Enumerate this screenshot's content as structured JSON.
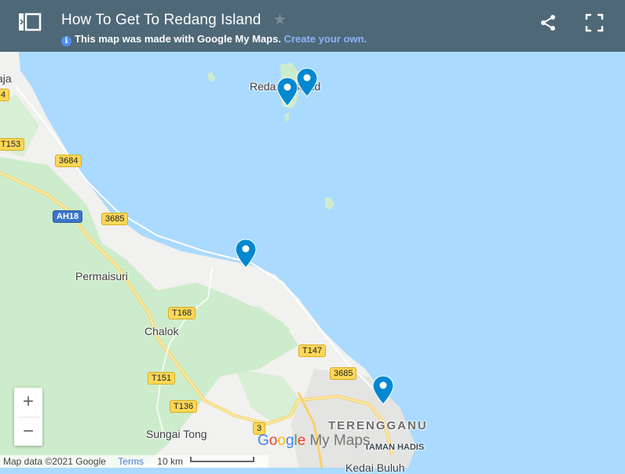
{
  "header": {
    "title": "How To Get To Redang Island",
    "subline_text": "This map was made with Google My Maps.",
    "subline_link": "Create your own.",
    "icons": [
      "panel-toggle-icon",
      "star-icon",
      "info-icon",
      "share-icon",
      "fullscreen-icon"
    ],
    "background_color": "#4e6878"
  },
  "map": {
    "water_color": "#aadaff",
    "land_color": "#f1f1ef",
    "forest_color": "#cdeccb",
    "pin_color": "#0288d1",
    "place_labels": [
      {
        "id": "redang-island",
        "text": "Redang Island"
      },
      {
        "id": "kuala-besut-partial",
        "text": "aja"
      },
      {
        "id": "permaisuri",
        "text": "Permaisuri"
      },
      {
        "id": "chalok",
        "text": "Chalok"
      },
      {
        "id": "sungai-tong",
        "text": "Sungai Tong"
      },
      {
        "id": "terengganu",
        "text": "TERENGGANU"
      },
      {
        "id": "taman-hadis",
        "text": "TAMAN HADIS"
      },
      {
        "id": "kedai-buluh",
        "text": "Kedai Buluh"
      }
    ],
    "road_shields": [
      {
        "id": "r4",
        "text": "4"
      },
      {
        "id": "t153",
        "text": "T153"
      },
      {
        "id": "r3684",
        "text": "3684"
      },
      {
        "id": "ah18",
        "text": "AH18"
      },
      {
        "id": "r3685a",
        "text": "3685"
      },
      {
        "id": "t168",
        "text": "T168"
      },
      {
        "id": "t147",
        "text": "T147"
      },
      {
        "id": "r3685b",
        "text": "3685"
      },
      {
        "id": "t151",
        "text": "T151"
      },
      {
        "id": "t136",
        "text": "T136"
      },
      {
        "id": "r3",
        "text": "3"
      }
    ],
    "markers": [
      {
        "name": "Redang Island marker 1"
      },
      {
        "name": "Redang Island marker 2"
      },
      {
        "name": "Merang jetty marker"
      },
      {
        "name": "Kuala Terengganu marker"
      }
    ]
  },
  "controls": {
    "zoom_in": "+",
    "zoom_out": "−"
  },
  "footer": {
    "attribution": "Map data ©2021 Google",
    "terms": "Terms",
    "scale": "10 km",
    "logo_google": [
      "G",
      "o",
      "o",
      "g",
      "l",
      "e"
    ],
    "logo_product": "My Maps"
  }
}
